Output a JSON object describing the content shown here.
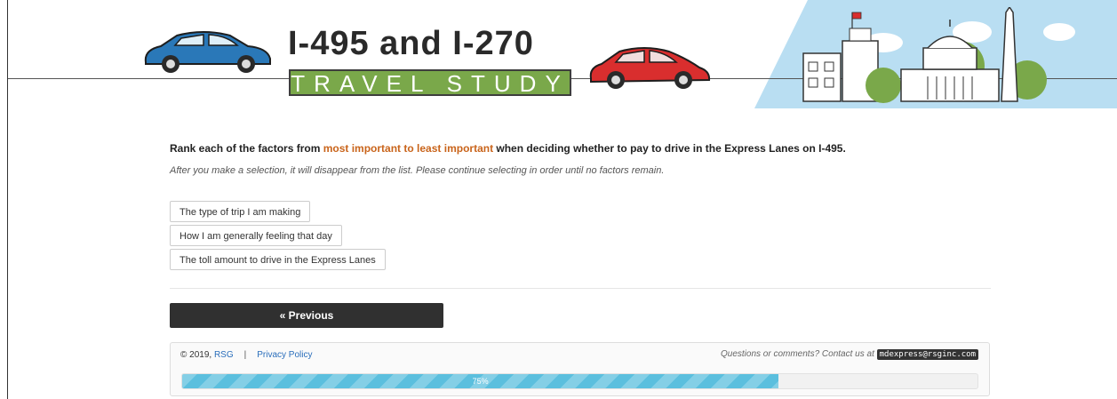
{
  "banner": {
    "title": "I-495 and I-270",
    "subtitle": "TRAVEL STUDY",
    "colors": {
      "green": "#7aa84a",
      "blue_car": "#2a78b8",
      "red_car": "#d92e2e",
      "sky": "#b9def2"
    }
  },
  "question": {
    "prefix": "Rank each of the factors from ",
    "highlight": "most important to least important",
    "suffix": " when deciding whether to pay to drive in the Express Lanes on I-495.",
    "instruction": "After you make a selection, it will disappear from the list. Please continue selecting in order until no factors remain."
  },
  "options": [
    "The type of trip I am making",
    "How I am generally feeling that day",
    "The toll amount to drive in the Express Lanes"
  ],
  "nav": {
    "previous_label": "« Previous"
  },
  "footer": {
    "copyright": "© 2019, ",
    "company": "RSG",
    "separator": "|",
    "privacy": "Privacy Policy",
    "contact_prefix": "Questions or comments? Contact us at ",
    "email": "mdexpress@rsginc.com"
  },
  "progress": {
    "value": 0.75,
    "label": "75%"
  }
}
